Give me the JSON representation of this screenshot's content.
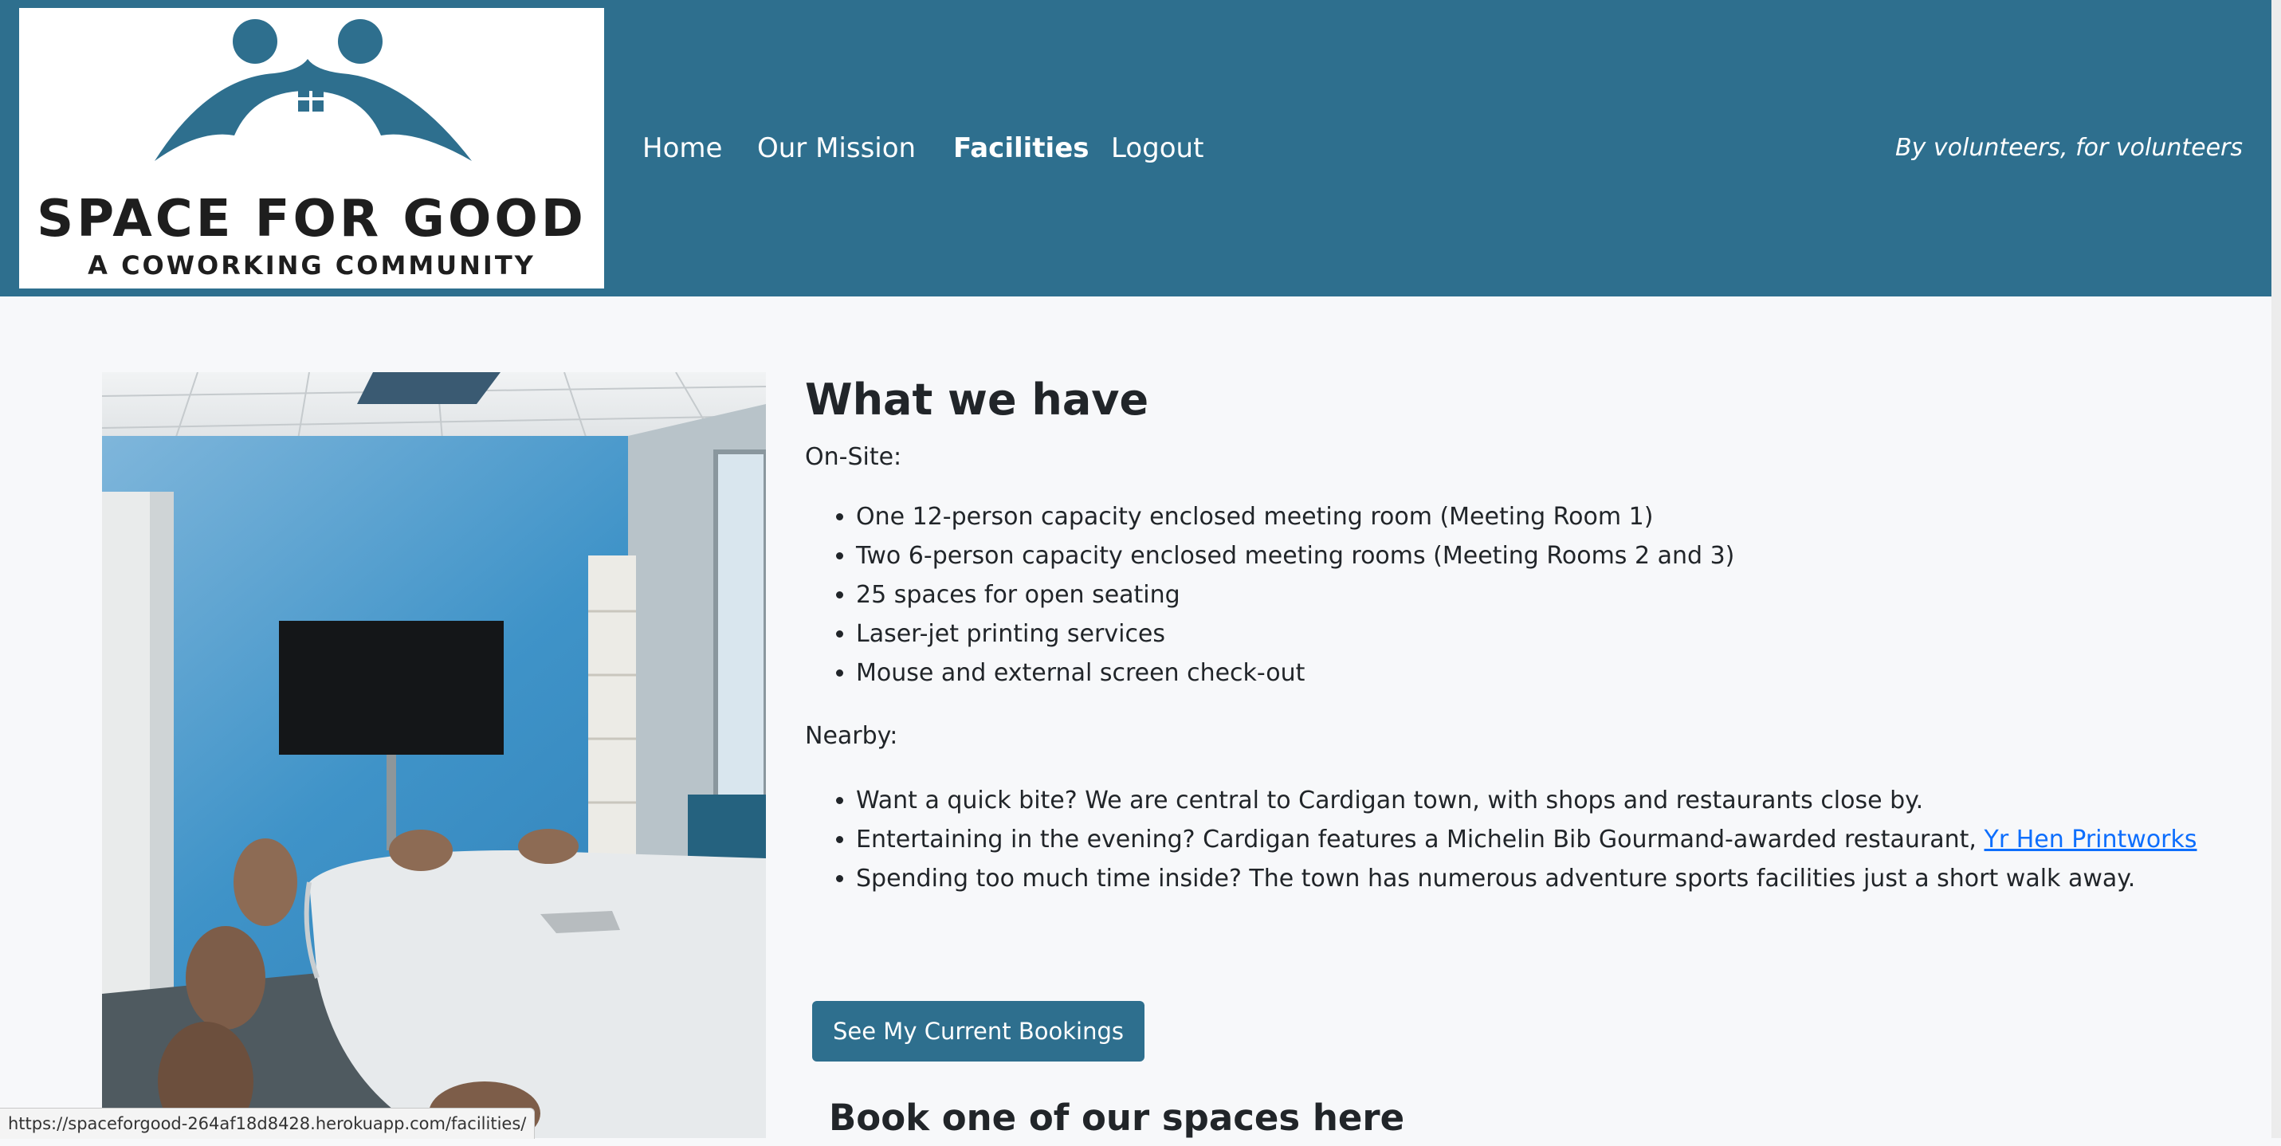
{
  "header": {
    "logo": {
      "line1": "SPACE FOR GOOD",
      "line2": "A COWORKING COMMUNITY",
      "icon": "people-house-logo-icon",
      "color": "#2e6f8e"
    },
    "nav": [
      {
        "label": "Home",
        "active": false
      },
      {
        "label": "Our Mission",
        "active": false
      },
      {
        "label": "Facilities",
        "active": true
      },
      {
        "label": "Logout",
        "active": false
      }
    ],
    "tagline": "By volunteers, for volunteers",
    "background_color": "#2e6f8e"
  },
  "main": {
    "photo": {
      "icon": "meeting-room-photo"
    },
    "title": "What we have",
    "onsite": {
      "label": "On-Site:",
      "items": [
        "One 12-person capacity enclosed meeting room (Meeting Room 1)",
        "Two 6-person capacity enclosed meeting rooms (Meeting Rooms 2 and 3)",
        "25 spaces for open seating",
        "Laser-jet printing services",
        "Mouse and external screen check-out"
      ]
    },
    "nearby": {
      "label": "Nearby:",
      "items": [
        {
          "text": "Want a quick bite? We are central to Cardigan town, with shops and restaurants close by."
        },
        {
          "text": "Entertaining in the evening? Cardigan features a Michelin Bib Gourmand-awarded restaurant, ",
          "link": "Yr Hen Printworks"
        },
        {
          "text": "Spending too much time inside? The town has numerous adventure sports facilities just a short walk away."
        }
      ]
    },
    "bookings_button": "See My Current Bookings",
    "book_heading": "Book one of our spaces here"
  },
  "status_bar": {
    "url": "https://spaceforgood-264af18d8428.herokuapp.com/facilities/"
  },
  "colors": {
    "brand": "#2e6f8e",
    "link": "#0d6efd",
    "page_background": "#f7f8fa"
  }
}
